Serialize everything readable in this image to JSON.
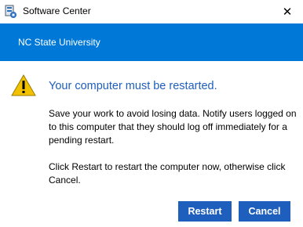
{
  "window": {
    "title": "Software Center",
    "icon": "software-center-icon",
    "close_label": "✕"
  },
  "banner": {
    "org_name": "NC State University",
    "color": "#0078d7"
  },
  "dialog": {
    "icon": "warning-icon",
    "heading": "Your computer must be restarted.",
    "message_1": "Save your work to avoid losing data. Notify users logged on to this computer that they should log off immediately for a pending restart.",
    "message_2": "Click Restart to restart the computer now, otherwise click Cancel."
  },
  "buttons": {
    "restart_label": "Restart",
    "cancel_label": "Cancel",
    "color": "#1e5ebc"
  }
}
